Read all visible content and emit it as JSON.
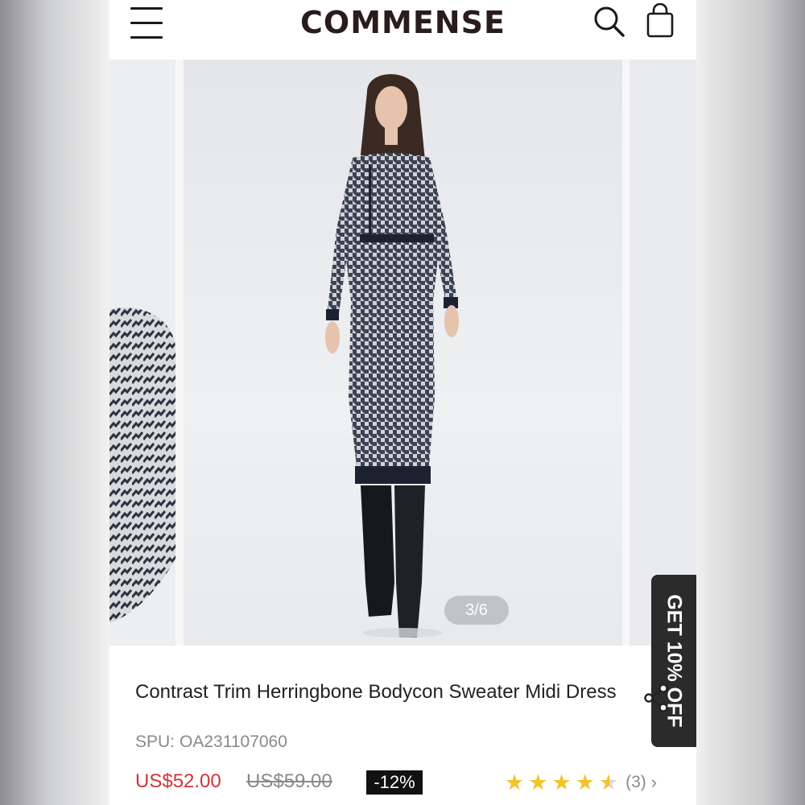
{
  "header": {
    "logo": "COMMENSE",
    "icons": [
      "menu-icon",
      "search-icon",
      "cart-icon"
    ]
  },
  "gallery": {
    "counter": "3/6",
    "current_index": 3,
    "total_images": 6
  },
  "promo": {
    "label": "GET 10% OFF"
  },
  "product": {
    "title": "Contrast Trim Herringbone Bodycon Sweater Midi Dress",
    "spu_label": "SPU:",
    "spu_value": "OA231107060",
    "price": "US$52.00",
    "original_price": "US$59.00",
    "discount": "-12%",
    "rating": 4.5,
    "reviews": "(3)"
  },
  "colors": {
    "price": "#d0343a",
    "star": "#f4c22b",
    "promo_bg": "#2b2b2b",
    "discount_bg": "#111111"
  }
}
